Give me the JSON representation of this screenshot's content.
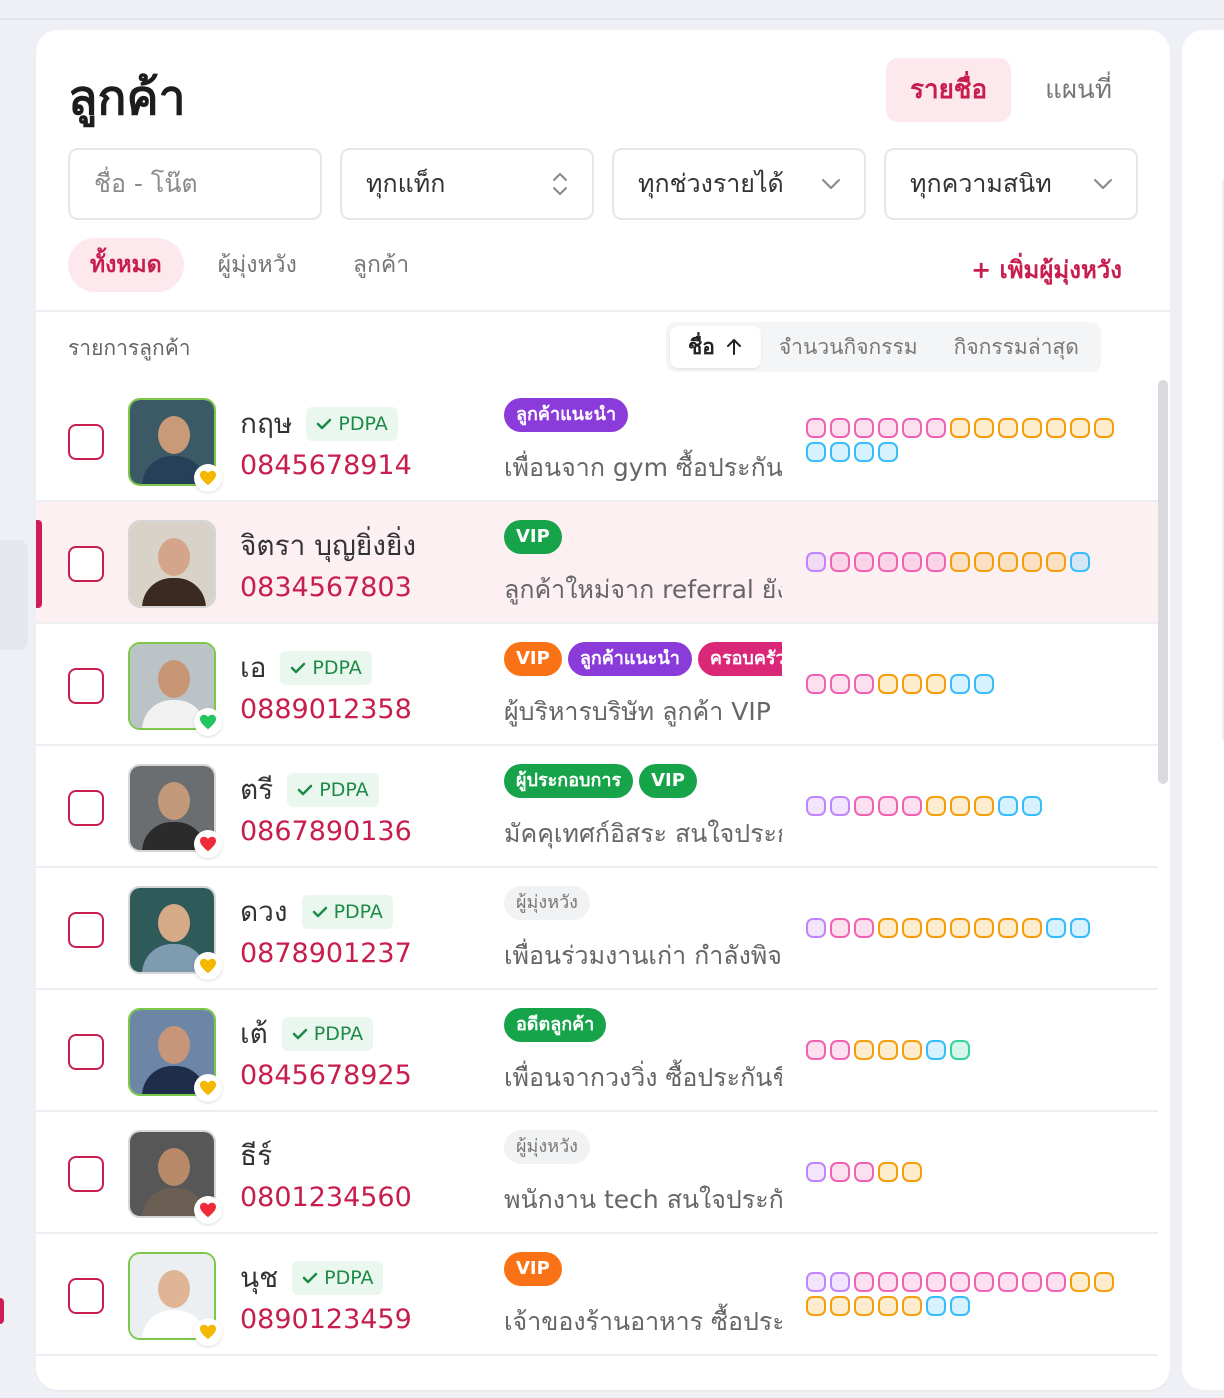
{
  "page": {
    "title": "ลูกค้า"
  },
  "view_tabs": [
    {
      "label": "รายชื่อ",
      "active": true
    },
    {
      "label": "แผนที่",
      "active": false
    }
  ],
  "filters": {
    "search_placeholder": "ชื่อ - โน๊ต",
    "tag": "ทุกแท็ก",
    "income": "ทุกช่วงรายได้",
    "interest": "ทุกความสนิท"
  },
  "status_tabs": [
    {
      "label": "ทั้งหมด",
      "active": true
    },
    {
      "label": "ผู้มุ่งหวัง",
      "active": false
    },
    {
      "label": "ลูกค้า",
      "active": false
    }
  ],
  "add_prospect_label": "+ เพิ่มผู้มุ่งหวัง",
  "list": {
    "label": "รายการลูกค้า",
    "sort": [
      {
        "label": "ชื่อ",
        "active": true,
        "icon": "arrow-up-icon"
      },
      {
        "label": "จำนวนกิจกรรม",
        "active": false
      },
      {
        "label": "กิจกรรมล่าสุด",
        "active": false
      }
    ]
  },
  "colors": {
    "accent": "#c81e4e",
    "tag_purple": "#8b3bd9",
    "tag_green": "#16a34a",
    "tag_orange": "#f97316",
    "tag_pink": "#db2777",
    "tag_gray": "#f1f2f4",
    "dot_pink": "#f062b4",
    "dot_purple": "#c084fc",
    "dot_orange": "#f59e0b",
    "dot_cyan": "#38bdf8",
    "dot_mint": "#34d399",
    "heart_yellow": "#f5b800",
    "heart_green": "#22c55e",
    "heart_red": "#ef2b3a"
  },
  "customers": [
    {
      "name": "กฤษ",
      "pdpa": "PDPA",
      "phone": "0845678914",
      "heart": "yellow",
      "border": "green",
      "tags": [
        {
          "label": "ลูกค้าแนะนำ",
          "color": "purple"
        }
      ],
      "note": "เพื่อนจาก gym ซื้อประกันสุขภาพ",
      "dots": [
        "pink",
        "pink",
        "pink",
        "pink",
        "pink",
        "pink",
        "orange",
        "orange",
        "orange",
        "orange",
        "orange",
        "orange",
        "orange",
        "cyan",
        "cyan",
        "cyan",
        "cyan"
      ]
    },
    {
      "name": "จิตรา บุญยิ่งยิ่ง",
      "pdpa": "",
      "phone": "0834567803",
      "heart": "",
      "border": "gray",
      "selected": true,
      "tags": [
        {
          "label": "VIP",
          "color": "green"
        }
      ],
      "note": "ลูกค้าใหม่จาก referral ยังไม่ได้นัด",
      "dots": [
        "purple",
        "pink",
        "pink",
        "pink",
        "pink",
        "pink",
        "orange",
        "orange",
        "orange",
        "orange",
        "orange",
        "cyan"
      ]
    },
    {
      "name": "เอ",
      "pdpa": "PDPA",
      "phone": "0889012358",
      "heart": "green",
      "border": "green",
      "tags": [
        {
          "label": "VIP",
          "color": "orange"
        },
        {
          "label": "ลูกค้าแนะนำ",
          "color": "purple"
        },
        {
          "label": "ครอบครัว",
          "color": "pink"
        }
      ],
      "note": "ผู้บริหารบริษัท ลูกค้า VIP",
      "dots": [
        "pink",
        "pink",
        "pink",
        "orange",
        "orange",
        "orange",
        "cyan",
        "cyan"
      ]
    },
    {
      "name": "ตรี",
      "pdpa": "PDPA",
      "phone": "0867890136",
      "heart": "red",
      "border": "gray",
      "tags": [
        {
          "label": "ผู้ประกอบการ",
          "color": "green"
        },
        {
          "label": "VIP",
          "color": "green"
        }
      ],
      "note": "มัคคุเทศก์อิสระ สนใจประกัน",
      "dots": [
        "purple",
        "purple",
        "pink",
        "pink",
        "pink",
        "orange",
        "orange",
        "orange",
        "cyan",
        "cyan"
      ]
    },
    {
      "name": "ดวง",
      "pdpa": "PDPA",
      "phone": "0878901237",
      "heart": "yellow",
      "border": "gray",
      "tags": [
        {
          "label": "ผู้มุ่งหวัง",
          "color": "gray"
        }
      ],
      "note": "เพื่อนร่วมงานเก่า กำลังพิจารณา",
      "dots": [
        "purple",
        "pink",
        "pink",
        "orange",
        "orange",
        "orange",
        "orange",
        "orange",
        "orange",
        "orange",
        "cyan",
        "cyan"
      ]
    },
    {
      "name": "เต้",
      "pdpa": "PDPA",
      "phone": "0845678925",
      "heart": "yellow",
      "border": "green",
      "tags": [
        {
          "label": "อดีตลูกค้า",
          "color": "green"
        }
      ],
      "note": "เพื่อนจากวงวิ่ง ซื้อประกันชีวิต",
      "dots": [
        "pink",
        "pink",
        "orange",
        "orange",
        "orange",
        "cyan",
        "mint"
      ]
    },
    {
      "name": "ธีร์",
      "pdpa": "",
      "phone": "0801234560",
      "heart": "red",
      "border": "gray",
      "tags": [
        {
          "label": "ผู้มุ่งหวัง",
          "color": "gray"
        }
      ],
      "note": "พนักงาน tech สนใจประกัน",
      "dots": [
        "purple",
        "pink",
        "pink",
        "orange",
        "orange"
      ]
    },
    {
      "name": "นุช",
      "pdpa": "PDPA",
      "phone": "0890123459",
      "heart": "yellow",
      "border": "green",
      "tags": [
        {
          "label": "VIP",
          "color": "orange"
        }
      ],
      "note": "เจ้าของร้านอาหาร ซื้อประกัน",
      "dots": [
        "purple",
        "purple",
        "pink",
        "pink",
        "pink",
        "pink",
        "pink",
        "pink",
        "pink",
        "pink",
        "pink",
        "orange",
        "orange",
        "orange",
        "orange",
        "orange",
        "orange",
        "orange",
        "cyan",
        "cyan"
      ]
    }
  ]
}
